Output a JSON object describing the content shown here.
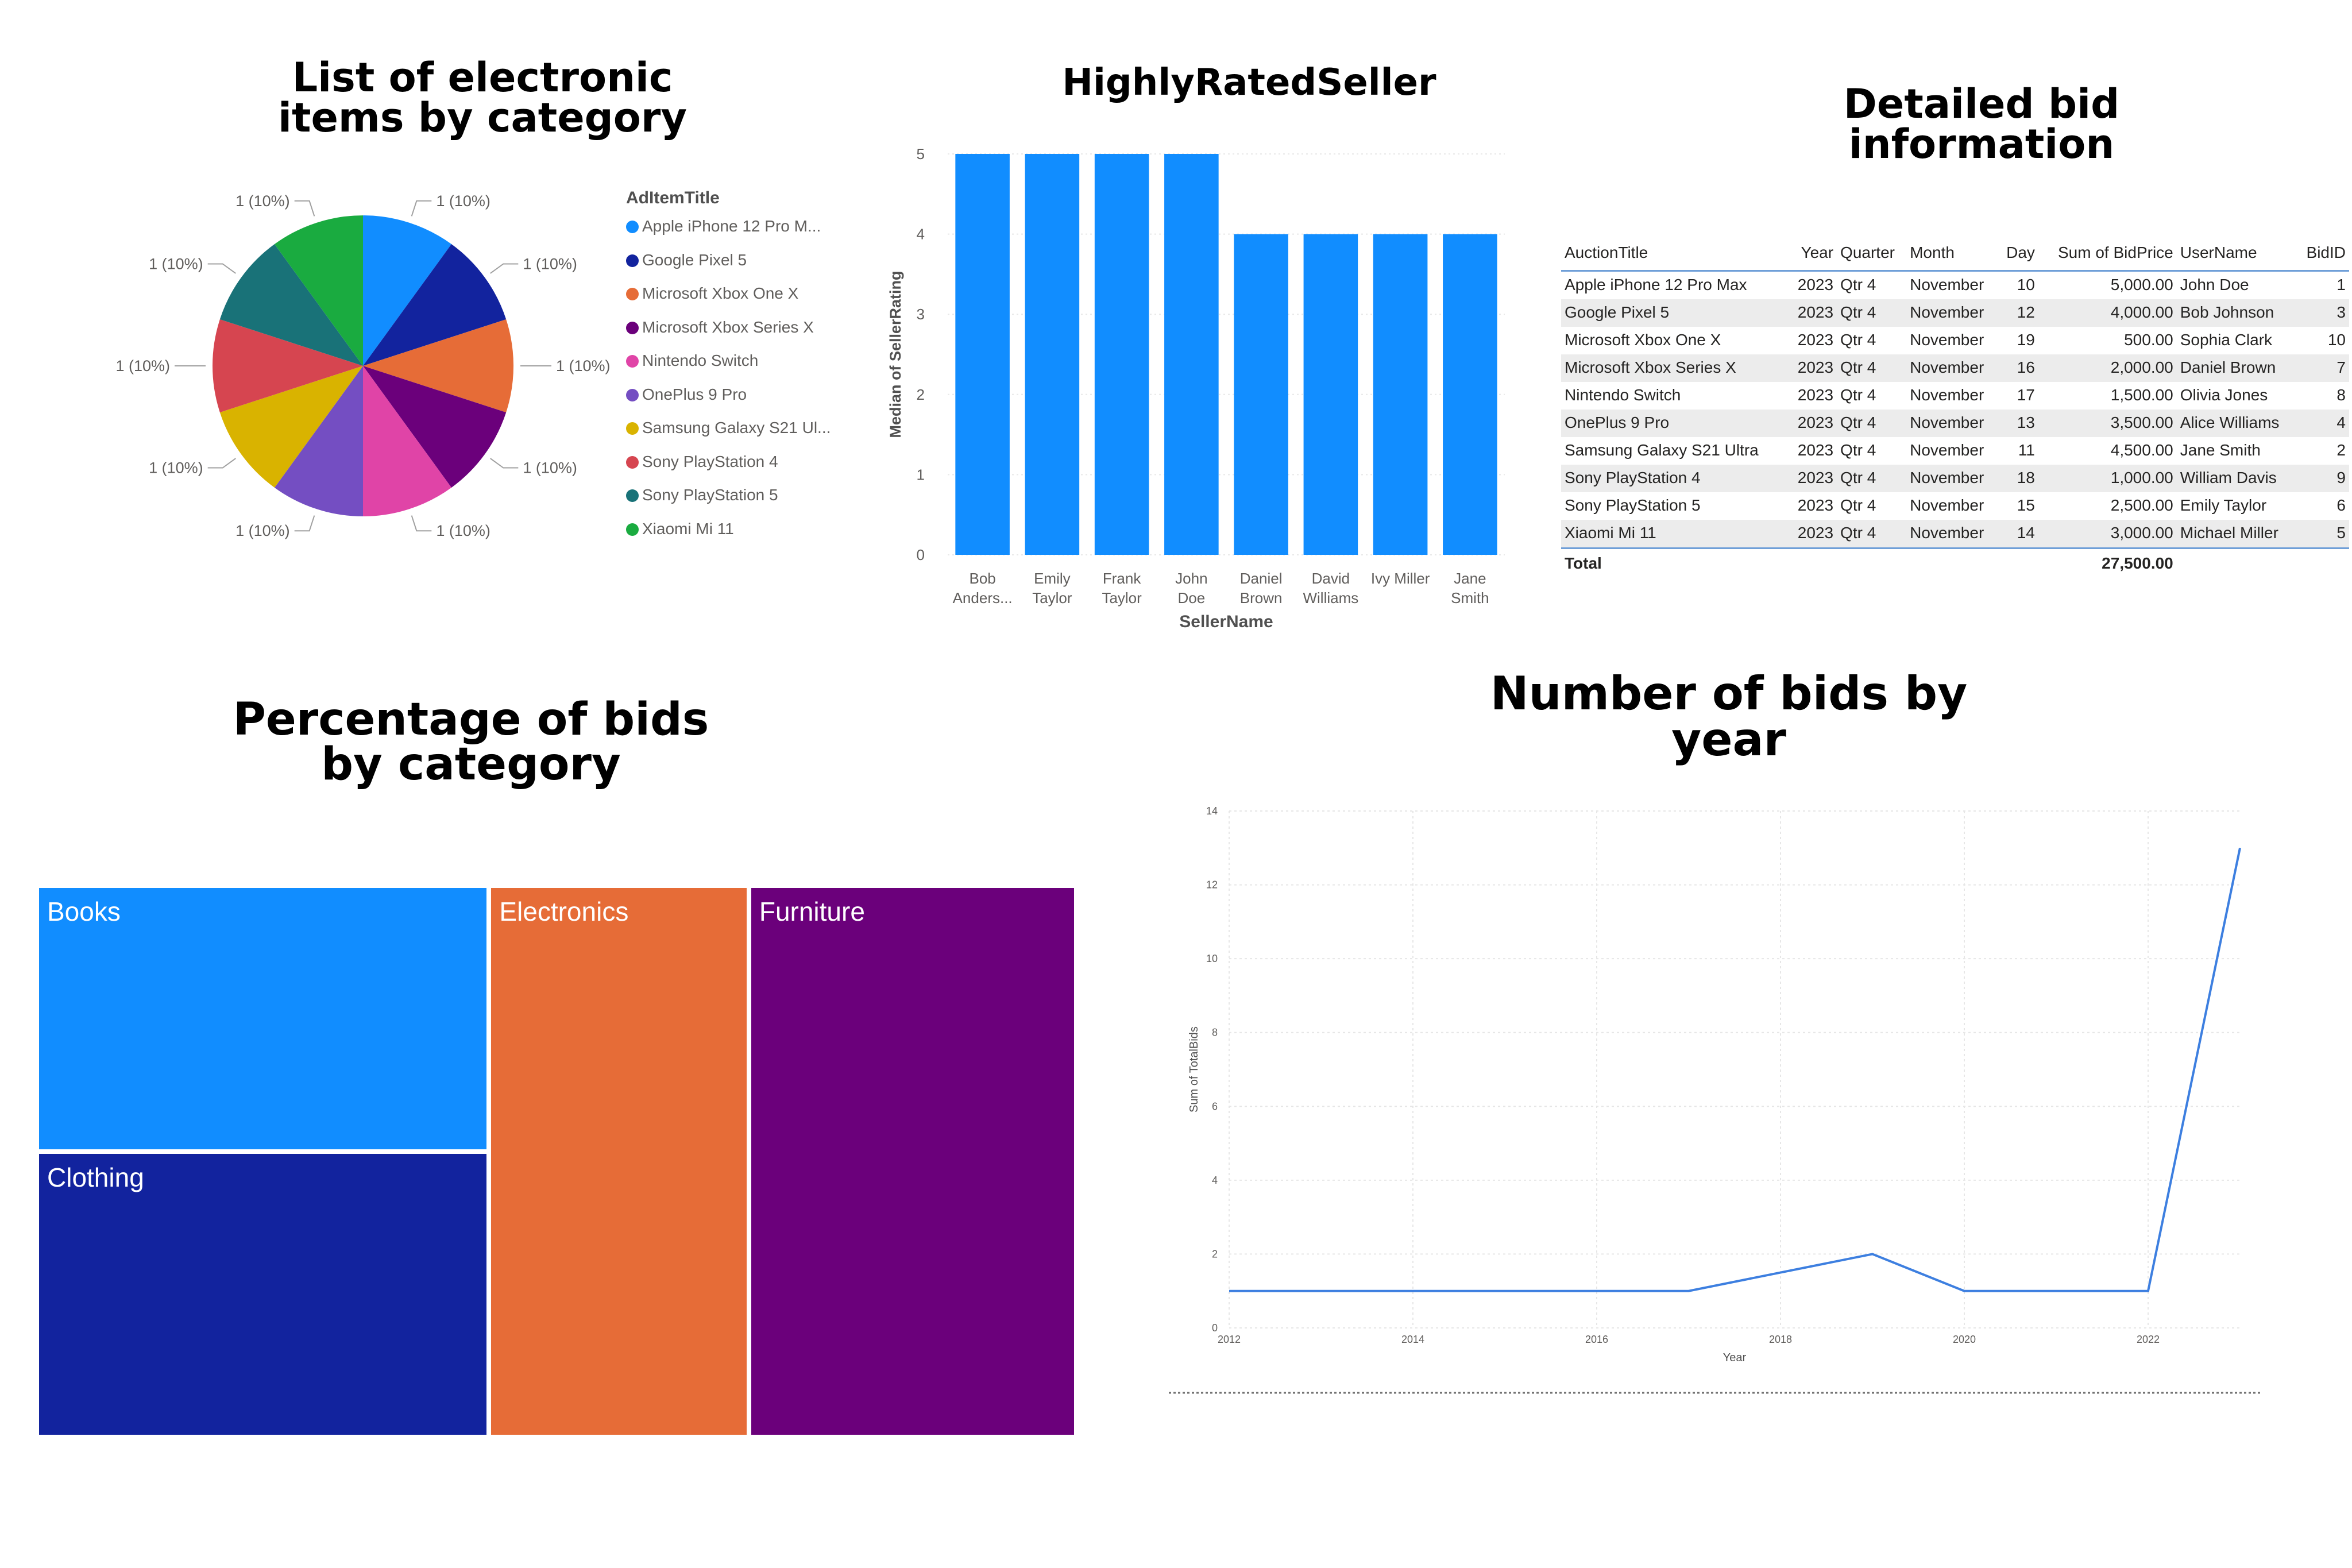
{
  "titles": {
    "pie": [
      "List of electronic",
      "items by category"
    ],
    "bar": [
      "HighlyRatedSeller"
    ],
    "table": [
      "Detailed bid",
      "information"
    ],
    "treemap": [
      "Percentage of bids",
      "by category"
    ],
    "line": [
      "Number of bids by",
      "year"
    ]
  },
  "chart_data": [
    {
      "type": "pie",
      "legend_title": "AdItemTitle",
      "categories": [
        "Apple iPhone 12 Pro M...",
        "Google Pixel 5",
        "Microsoft Xbox One X",
        "Microsoft Xbox Series X",
        "Nintendo Switch",
        "OnePlus 9 Pro",
        "Samsung Galaxy S21 Ul...",
        "Sony PlayStation 4",
        "Sony PlayStation 5",
        "Xiaomi Mi 11"
      ],
      "values": [
        1,
        1,
        1,
        1,
        1,
        1,
        1,
        1,
        1,
        1
      ],
      "data_labels": [
        "1 (10%)",
        "1 (10%)",
        "1 (10%)",
        "1 (10%)",
        "1 (10%)",
        "1 (10%)",
        "1 (10%)",
        "1 (10%)",
        "1 (10%)",
        "1 (10%)"
      ],
      "colors": [
        "#118DFF",
        "#12239E",
        "#E66C37",
        "#6B007B",
        "#E044A7",
        "#744EC2",
        "#D9B300",
        "#D64550",
        "#197278",
        "#1AAB40"
      ],
      "legend_position": "right"
    },
    {
      "type": "bar",
      "categories": [
        [
          "Bob",
          "Anders..."
        ],
        [
          "Emily",
          "Taylor"
        ],
        [
          "Frank",
          "Taylor"
        ],
        [
          "John",
          "Doe"
        ],
        [
          "Daniel",
          "Brown"
        ],
        [
          "David",
          "Williams"
        ],
        [
          "Ivy Miller"
        ],
        [
          "Jane",
          "Smith"
        ]
      ],
      "values": [
        5,
        5,
        5,
        5,
        4,
        4,
        4,
        4
      ],
      "xlabel": "SellerName",
      "ylabel": "Median of SellerRating",
      "ylim": [
        0,
        5
      ],
      "yticks": [
        0,
        1,
        2,
        3,
        4,
        5
      ],
      "color": "#118DFF",
      "grid": true
    },
    {
      "type": "table",
      "columns": [
        "AuctionTitle",
        "Year",
        "Quarter",
        "Month",
        "Day",
        "Sum of BidPrice",
        "UserName",
        "BidID"
      ],
      "rows": [
        [
          "Apple iPhone 12 Pro Max",
          "2023",
          "Qtr 4",
          "November",
          "10",
          "5,000.00",
          "John Doe",
          "1"
        ],
        [
          "Google Pixel 5",
          "2023",
          "Qtr 4",
          "November",
          "12",
          "4,000.00",
          "Bob Johnson",
          "3"
        ],
        [
          "Microsoft Xbox One X",
          "2023",
          "Qtr 4",
          "November",
          "19",
          "500.00",
          "Sophia Clark",
          "10"
        ],
        [
          "Microsoft Xbox Series X",
          "2023",
          "Qtr 4",
          "November",
          "16",
          "2,000.00",
          "Daniel Brown",
          "7"
        ],
        [
          "Nintendo Switch",
          "2023",
          "Qtr 4",
          "November",
          "17",
          "1,500.00",
          "Olivia Jones",
          "8"
        ],
        [
          "OnePlus 9 Pro",
          "2023",
          "Qtr 4",
          "November",
          "13",
          "3,500.00",
          "Alice Williams",
          "4"
        ],
        [
          "Samsung Galaxy S21 Ultra",
          "2023",
          "Qtr 4",
          "November",
          "11",
          "4,500.00",
          "Jane Smith",
          "2"
        ],
        [
          "Sony PlayStation 4",
          "2023",
          "Qtr 4",
          "November",
          "18",
          "1,000.00",
          "William Davis",
          "9"
        ],
        [
          "Sony PlayStation 5",
          "2023",
          "Qtr 4",
          "November",
          "15",
          "2,500.00",
          "Emily Taylor",
          "6"
        ],
        [
          "Xiaomi Mi 11",
          "2023",
          "Qtr 4",
          "November",
          "14",
          "3,000.00",
          "Michael Miller",
          "5"
        ]
      ],
      "total_label": "Total",
      "total_value": "27,500.00"
    },
    {
      "type": "treemap",
      "categories": [
        "Books",
        "Clothing",
        "Electronics",
        "Furniture"
      ],
      "values": [
        21,
        22.5,
        25,
        31.5
      ],
      "colors": [
        "#118DFF",
        "#12239E",
        "#E66C37",
        "#6B007B"
      ]
    },
    {
      "type": "line",
      "x": [
        2012,
        2013,
        2014,
        2015,
        2016,
        2017,
        2018,
        2019,
        2020,
        2021,
        2022,
        2023
      ],
      "values": [
        1,
        1,
        1,
        1,
        1,
        1,
        1.5,
        2,
        1,
        1,
        1,
        13
      ],
      "xlabel": "Year",
      "ylabel": "Sum of TotalBids",
      "xticks": [
        2012,
        2014,
        2016,
        2018,
        2020,
        2022
      ],
      "yticks": [
        0,
        2,
        4,
        6,
        8,
        10,
        12,
        14
      ],
      "xlim": [
        2012,
        2023
      ],
      "ylim": [
        0,
        14
      ],
      "color": "#3D7FE0",
      "grid": true
    }
  ]
}
